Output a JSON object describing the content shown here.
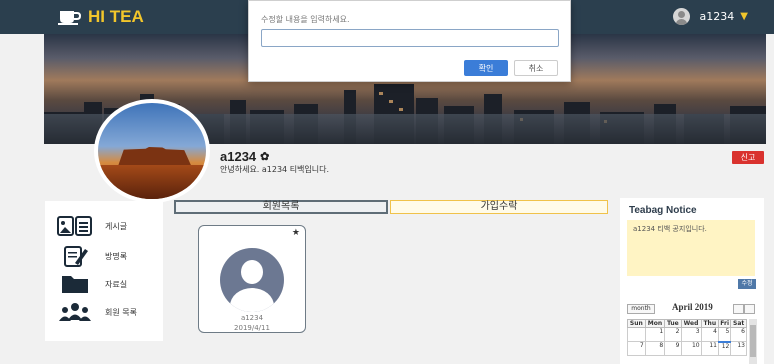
{
  "header": {
    "logo_text": "HI TEA",
    "user_name": "a1234",
    "caret": "▼"
  },
  "dialog": {
    "message": "수정할 내용을 입력하세요.",
    "input_value": "",
    "ok_label": "확인",
    "cancel_label": "취소"
  },
  "profile": {
    "name": "a1234",
    "greeting": "안녕하세요. a1234 티백입니다.",
    "report_label": "신고"
  },
  "menu": {
    "items": [
      {
        "label": "게시글",
        "icon": "post-icon"
      },
      {
        "label": "방명록",
        "icon": "guestbook-icon"
      },
      {
        "label": "자료실",
        "icon": "folder-icon"
      },
      {
        "label": "회원 목록",
        "icon": "members-icon"
      }
    ]
  },
  "tabs": {
    "members": "회원목록",
    "approval": "가입수락"
  },
  "member_card": {
    "star": "★",
    "name": "a1234",
    "date": "2019/4/11"
  },
  "notice": {
    "title": "Teabag Notice",
    "body": "a1234 티백 공지입니다.",
    "edit_label": "수정"
  },
  "calendar": {
    "view_button": "month",
    "title": "April 2019",
    "weekdays": [
      "Sun",
      "Mon",
      "Tue",
      "Wed",
      "Thu",
      "Fri",
      "Sat"
    ],
    "week1": [
      "",
      "1",
      "2",
      "3",
      "4",
      "5",
      "6"
    ],
    "week2": [
      "7",
      "8",
      "9",
      "10",
      "11",
      "12",
      "13"
    ]
  },
  "colors": {
    "topbar": "#2b3f4e",
    "accent": "#f2c62b",
    "primary_button": "#3b7dd8",
    "report": "#d9322e"
  }
}
